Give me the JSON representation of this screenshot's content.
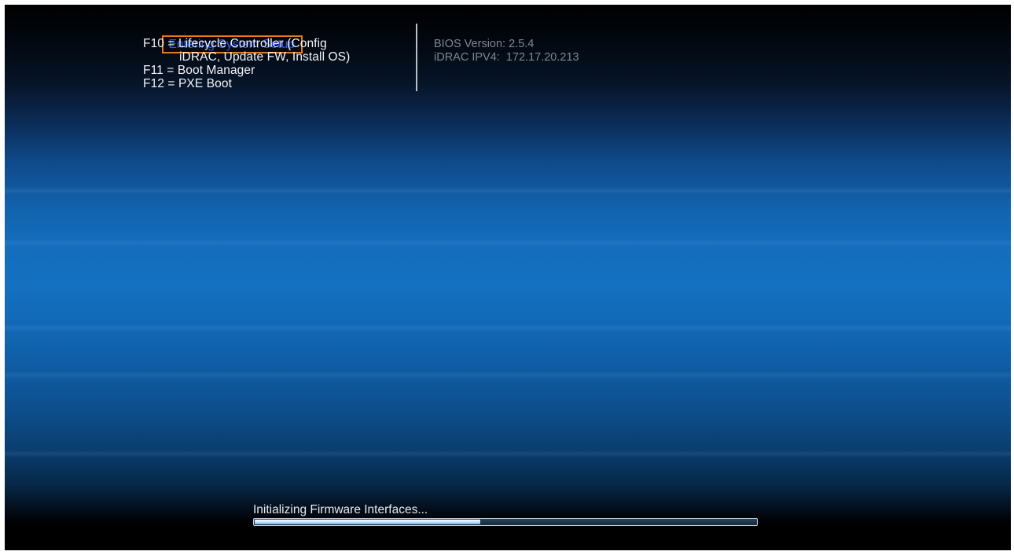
{
  "boot_menu": {
    "entering_setup": "Entering System Setup",
    "f10_line1": "F10 = Lifecycle Controller (Config",
    "f10_line2": "iDRAC, Update FW, Install OS)",
    "f11": "F11 = Boot Manager",
    "f12": "F12 = PXE Boot"
  },
  "system_info": {
    "bios_version": "BIOS Version: 2.5.4",
    "idrac_ipv4": "iDRAC IPV4:  172.17.20.213"
  },
  "status": {
    "message": "Initializing Firmware Interfaces...",
    "progress": 0.45
  },
  "colors": {
    "highlight_border": "#e77b22",
    "highlight_text": "#2d5bff",
    "menu_text": "#f2f4f8",
    "info_text": "#7f8791"
  }
}
